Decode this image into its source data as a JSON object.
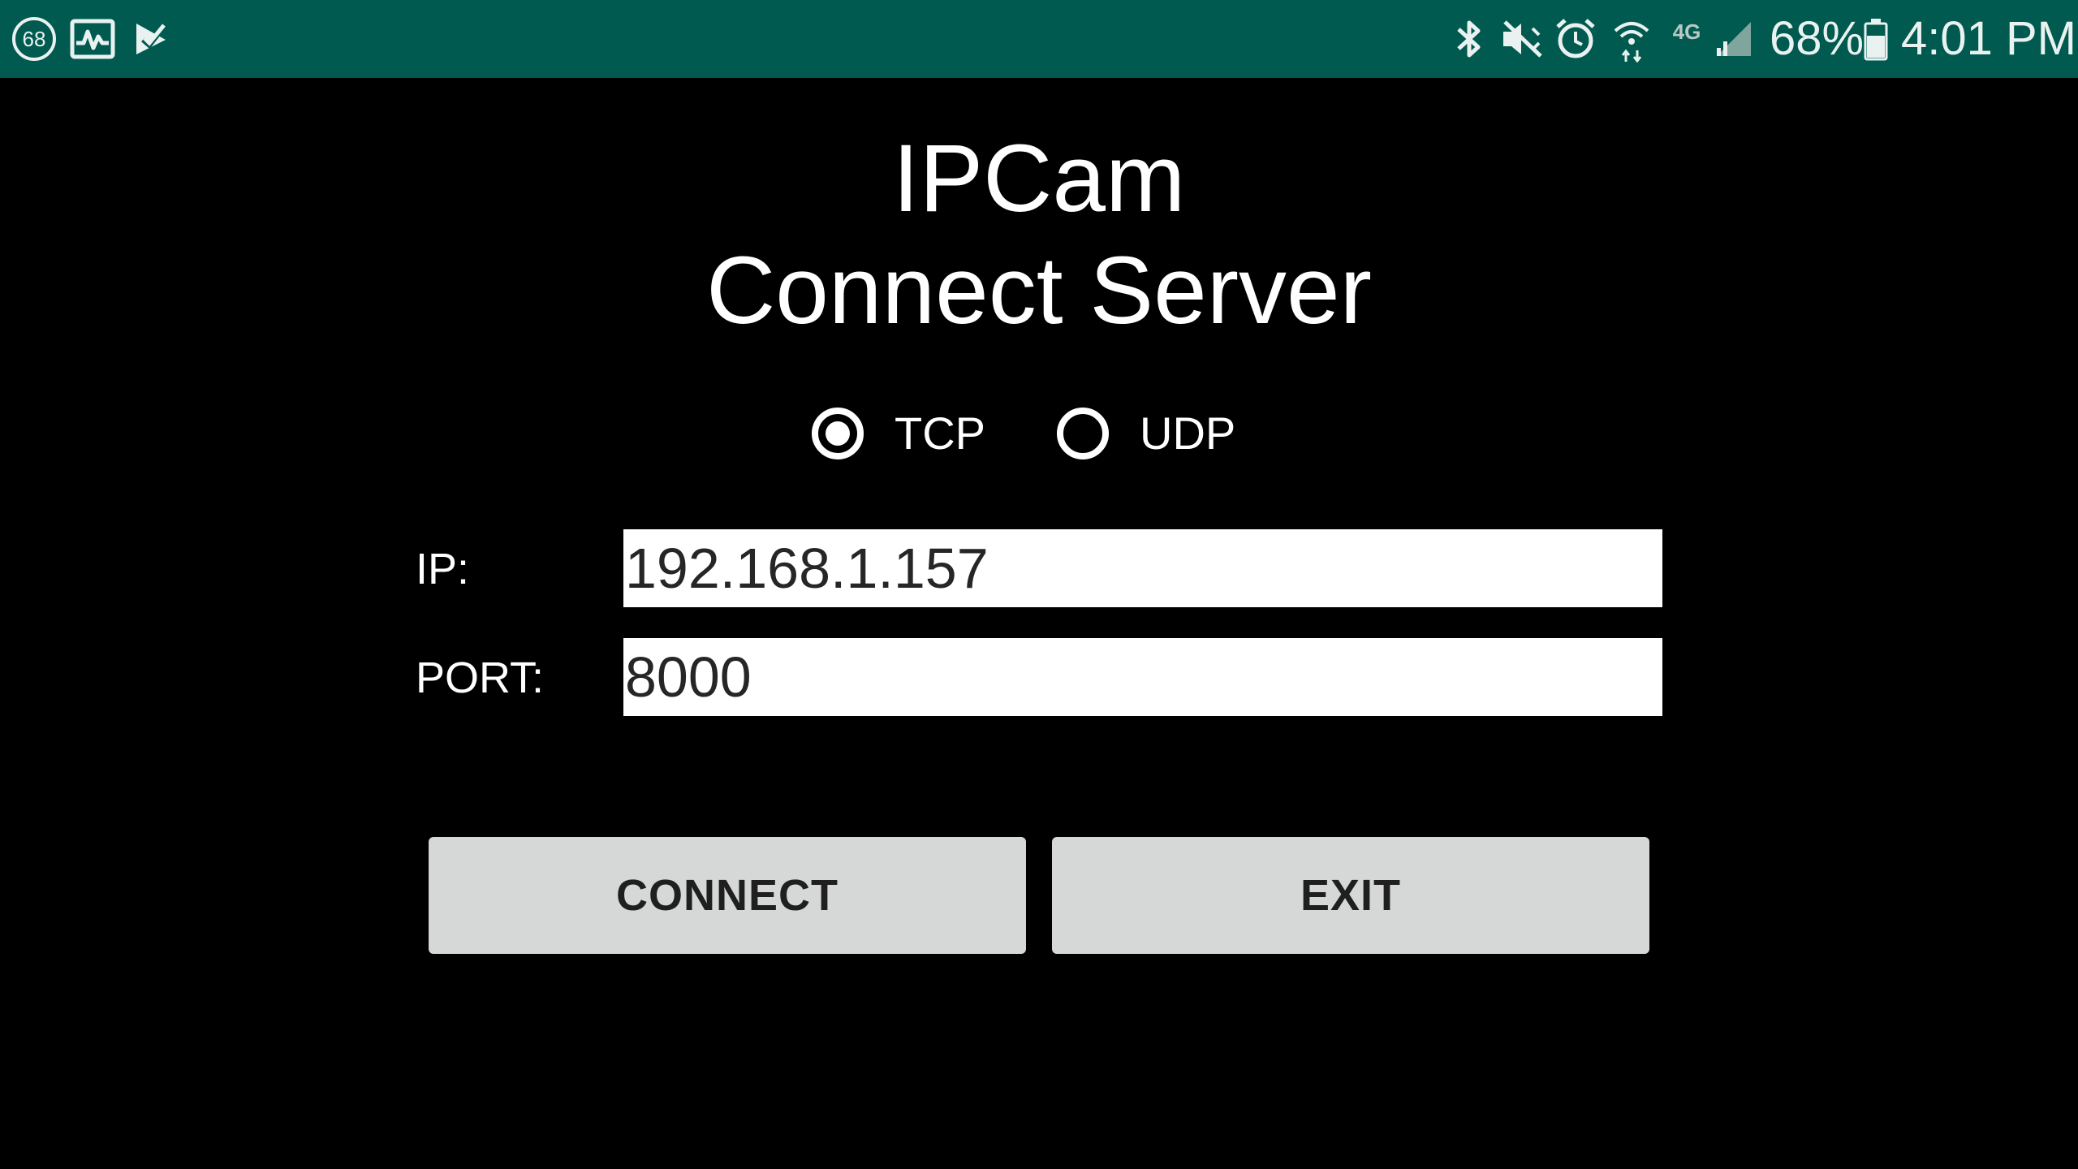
{
  "status_bar": {
    "background": "#005a4f",
    "left_icons": [
      "badge-68-icon",
      "activity-pulse-icon",
      "task-check-icon"
    ],
    "badge_number": "68",
    "right_icons": [
      "bluetooth-icon",
      "vibrate-mute-icon",
      "alarm-clock-icon",
      "wifi-data-icon",
      "4g-lte-icon",
      "cellular-signal-icon",
      "battery-icon"
    ],
    "network_label": "4G",
    "battery_percent": "68%",
    "battery_level": 0.68,
    "time": "4:01 PM"
  },
  "app": {
    "title_line1": "IPCam",
    "title_line2": "Connect Server"
  },
  "protocol": {
    "options": [
      {
        "label": "TCP",
        "selected": true
      },
      {
        "label": "UDP",
        "selected": false
      }
    ]
  },
  "form": {
    "ip_label": "IP:",
    "ip_value": "192.168.1.157",
    "port_label": "PORT:",
    "port_value": "8000"
  },
  "buttons": {
    "connect_label": "CONNECT",
    "exit_label": "EXIT"
  },
  "colors": {
    "background": "#000000",
    "status_bar": "#005a4f",
    "button_bg": "#d6d7d7",
    "text_primary": "#ffffff"
  }
}
